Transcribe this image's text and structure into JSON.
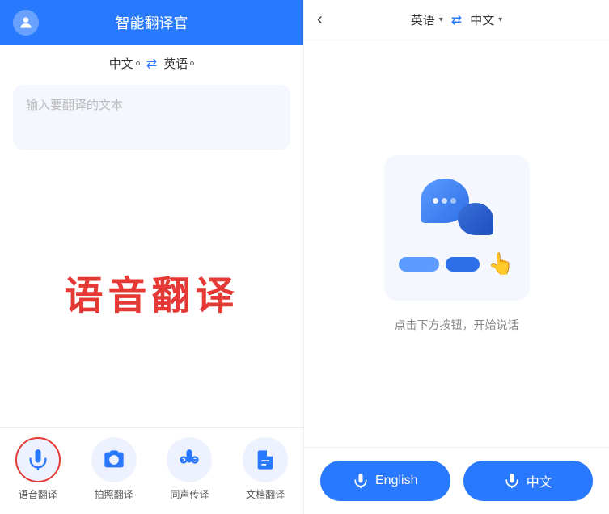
{
  "left": {
    "header": {
      "title": "智能翻译官",
      "avatar_label": "user-avatar"
    },
    "lang_bar": {
      "source": "中文",
      "target": "英语",
      "swap_symbol": "⇄"
    },
    "input": {
      "placeholder": "输入要翻译的文本"
    },
    "voice_section": {
      "big_text": "语音翻译"
    },
    "nav": [
      {
        "id": "voice",
        "label": "语音翻译",
        "icon": "🎤",
        "active": true
      },
      {
        "id": "photo",
        "label": "拍照翻译",
        "icon": "📷",
        "active": false
      },
      {
        "id": "simultaneous",
        "label": "同声传译",
        "icon": "🎧",
        "active": false
      },
      {
        "id": "document",
        "label": "文档翻译",
        "icon": "📄",
        "active": false
      }
    ]
  },
  "right": {
    "header": {
      "back": "‹",
      "source": "英语",
      "target": "中文",
      "swap_symbol": "⇄"
    },
    "hint": "点击下方按钮，开始说话",
    "buttons": [
      {
        "id": "english-btn",
        "label": "English",
        "lang": "en"
      },
      {
        "id": "chinese-btn",
        "label": "中文",
        "lang": "zh"
      }
    ]
  }
}
